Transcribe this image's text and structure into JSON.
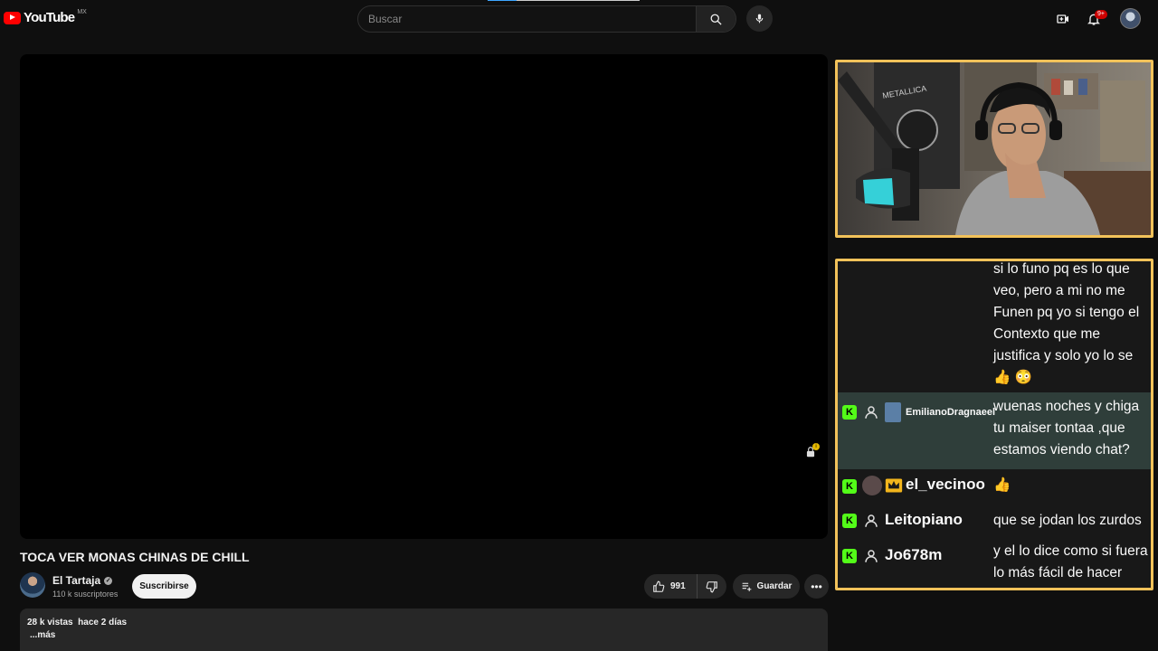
{
  "header": {
    "logo_text": "YouTube",
    "country": "MX",
    "search_placeholder": "Buscar",
    "notifications_badge": "9+",
    "icons": [
      "search-icon",
      "mic-icon",
      "create-icon",
      "bell-icon",
      "avatar"
    ],
    "brand_color": "#ff0000"
  },
  "video": {
    "title": "TOCA VER MONAS CHINAS DE CHILL",
    "channel_name": "El Tartaja",
    "subscribers": "110 k suscriptores",
    "subscribe_label": "Suscribirse",
    "likes": "991",
    "save_label": "Guardar",
    "views": "28 k vistas",
    "date": "hace 2 días",
    "more_label": "...más"
  },
  "stream_overlay": {
    "frame_color": "#f2c25a",
    "chat": [
      {
        "user": "",
        "text": "si lo funo pq es lo que veo, pero a mi no me Funen pq yo si tengo el Contexto que me justifica y solo yo lo se 👍 😳",
        "highlighted": false
      },
      {
        "user": "EmilianoDragnaeel",
        "text": "wuenas noches y chiga tu maiser tontaa ,que estamos viendo chat?",
        "highlighted": true
      },
      {
        "user": "el_vecinoo",
        "text": "👍",
        "highlighted": false
      },
      {
        "user": "Leitopiano",
        "text": "que se jodan los zurdos",
        "highlighted": false
      },
      {
        "user": "Jo678m",
        "text": "y el lo dice como si fuera lo más fácil de hacer",
        "highlighted": false
      }
    ]
  }
}
